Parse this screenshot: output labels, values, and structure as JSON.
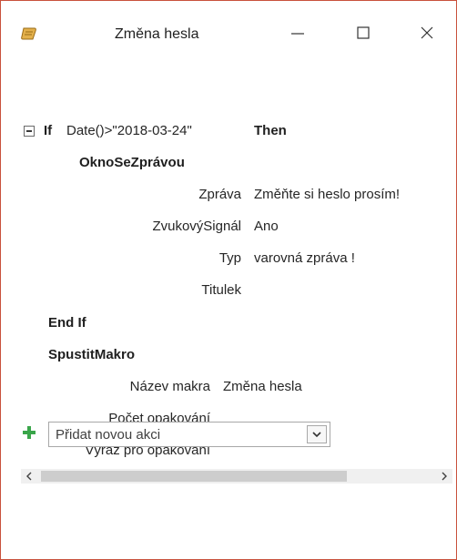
{
  "window": {
    "title": "Změna hesla",
    "icon": "macro-scroll-icon",
    "accent_color": "#c9513d"
  },
  "macro": {
    "if_block": {
      "keyword_if": "If",
      "condition": "Date()>\"2018-03-24\"",
      "keyword_then": "Then",
      "action_name": "OknoSeZprávou",
      "arguments": [
        {
          "label": "Zpráva",
          "value": "Změňte si heslo prosím!"
        },
        {
          "label": "ZvukovýSignál",
          "value": "Ano"
        },
        {
          "label": "Typ",
          "value": "varovná zpráva !"
        },
        {
          "label": "Titulek",
          "value": ""
        }
      ],
      "keyword_end_if": "End If"
    },
    "run_macro": {
      "action_name": "SpustitMakro",
      "arguments": [
        {
          "label": "Název makra",
          "value": "Změna hesla"
        },
        {
          "label": "Počet opakování",
          "value": ""
        },
        {
          "label": "Výraz pro opakování",
          "value": ""
        }
      ]
    },
    "add_action": {
      "placeholder": "Přidat novou akci",
      "icon_color": "#3aa54a"
    }
  }
}
